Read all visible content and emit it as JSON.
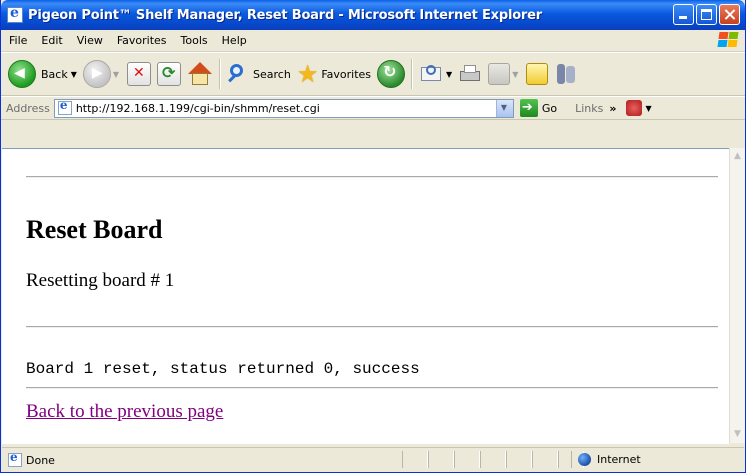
{
  "window": {
    "title": "Pigeon Point™ Shelf Manager, Reset Board - Microsoft Internet Explorer"
  },
  "menu": [
    "File",
    "Edit",
    "View",
    "Favorites",
    "Tools",
    "Help"
  ],
  "toolbar": {
    "back_label": "Back",
    "search_label": "Search",
    "favorites_label": "Favorites"
  },
  "address": {
    "label": "Address",
    "url": "http://192.168.1.199/cgi-bin/shmm/reset.cgi",
    "go_label": "Go",
    "links_label": "Links"
  },
  "page": {
    "heading": "Reset Board",
    "message": "Resetting board # 1",
    "result": "Board 1 reset, status returned 0, success",
    "back_link": "Back to the previous page"
  },
  "status": {
    "text": "Done",
    "zone": "Internet"
  },
  "colors": {
    "title_bar": "#0a5ae0",
    "visited_link": "#800080",
    "chrome": "#ece9d8"
  }
}
